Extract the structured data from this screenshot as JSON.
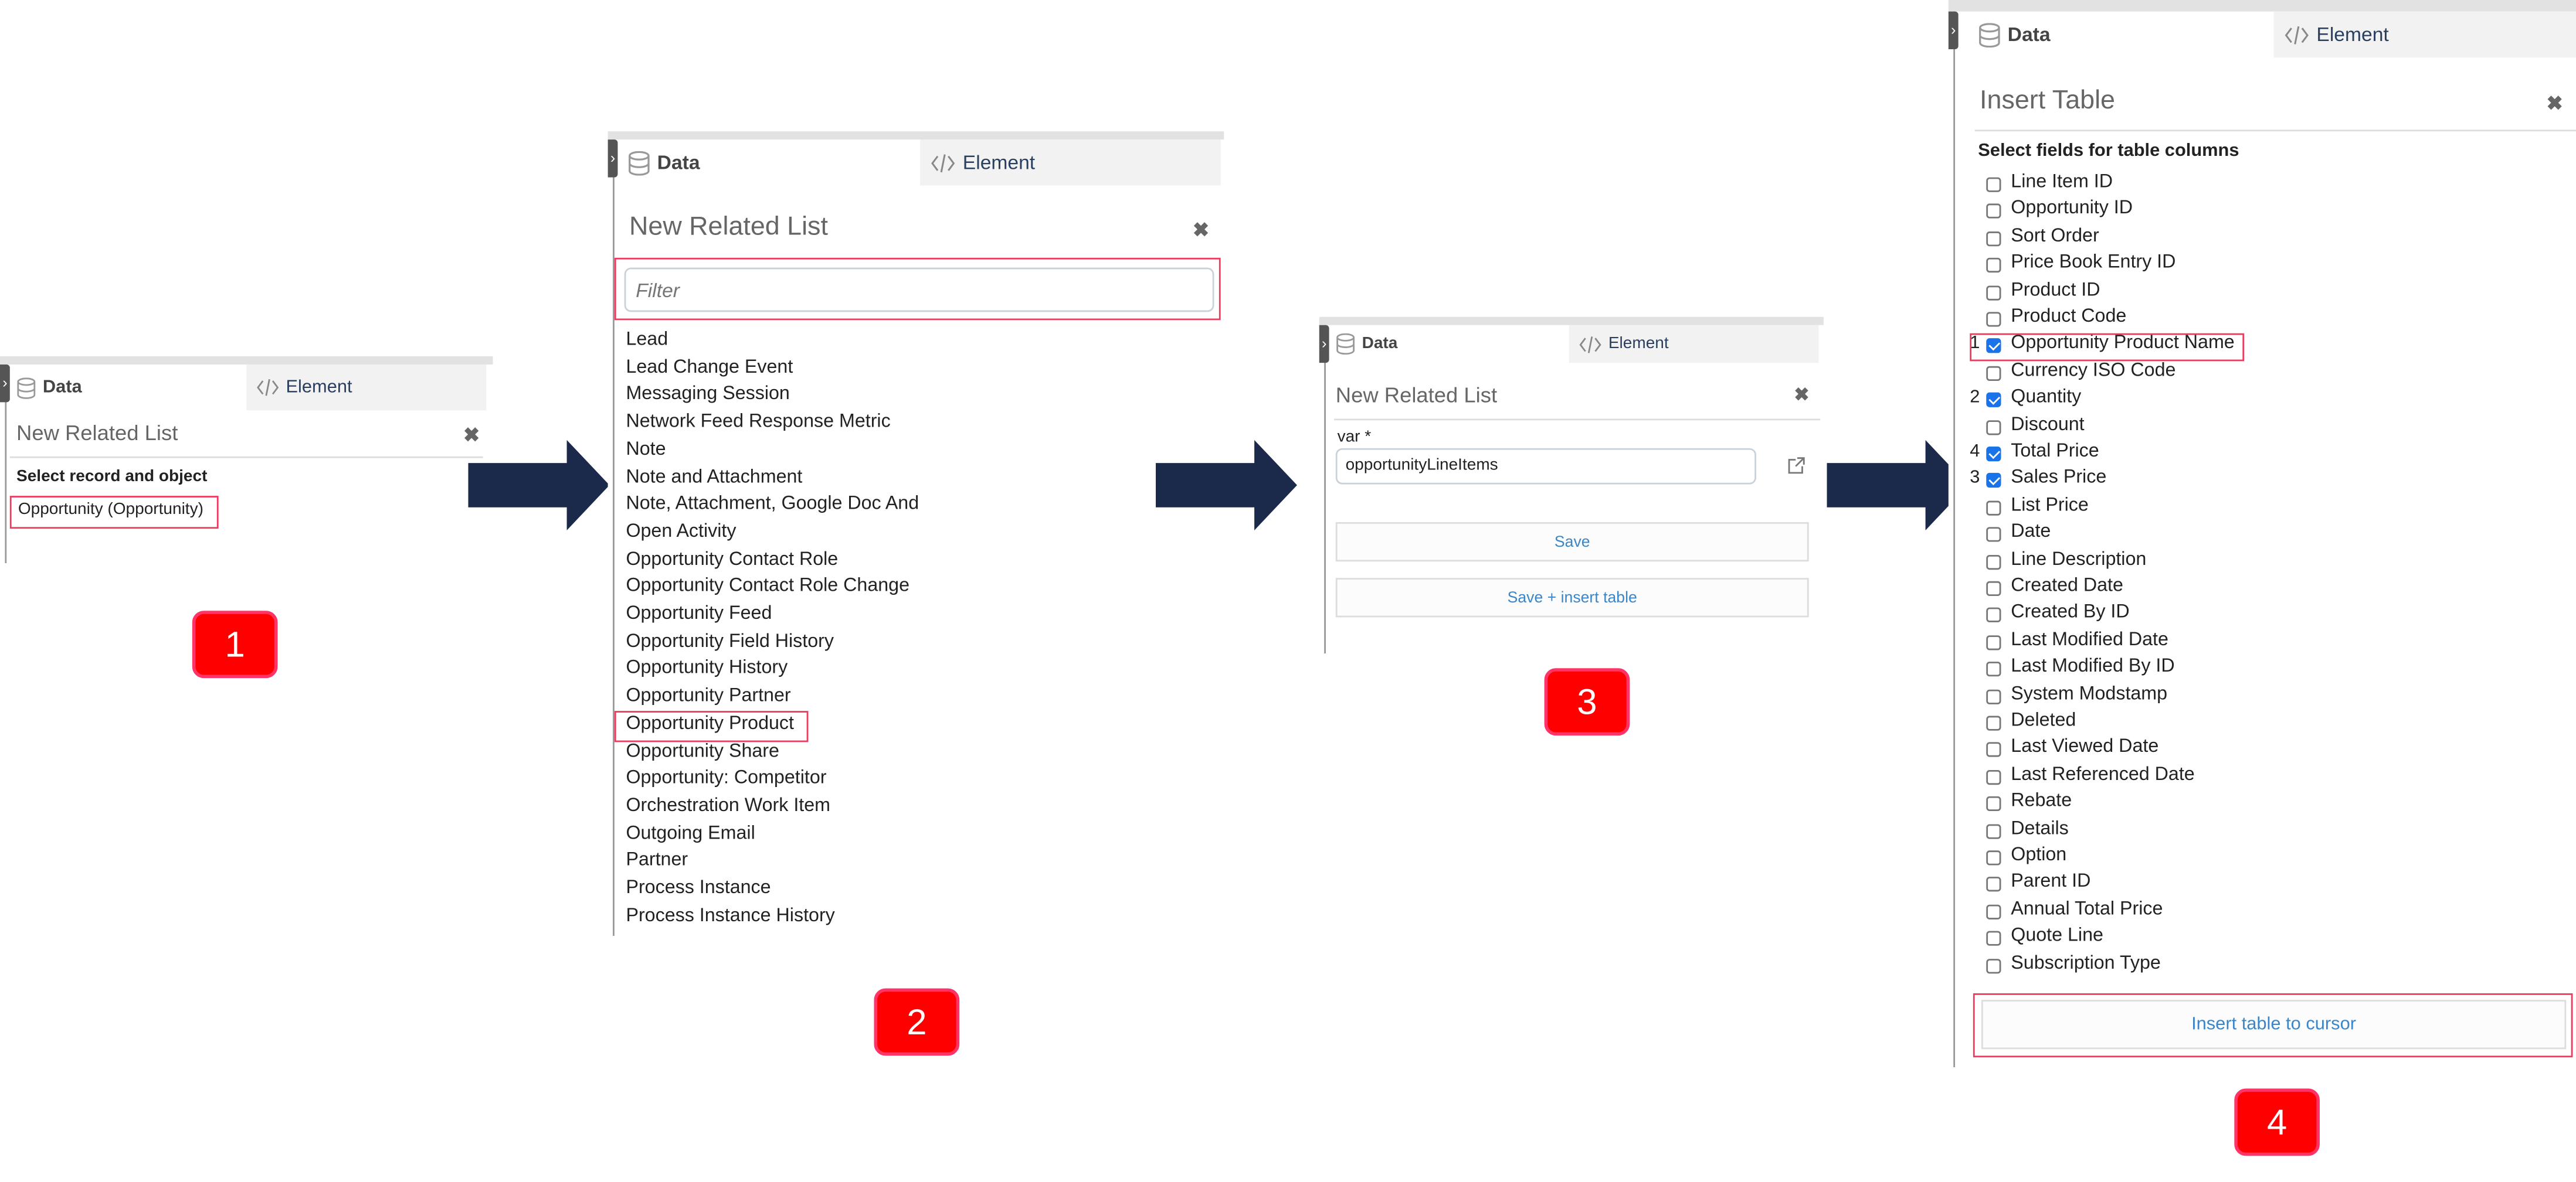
{
  "colors": {
    "arrow": "#1b2a4a",
    "highlight": "#ee3a5e",
    "badge": "#ff0000",
    "checkbox": "#1a73e8",
    "button_text": "#3a86c8"
  },
  "tabs": {
    "data": "Data",
    "element": "Element",
    "data_icon": "database-icon",
    "element_icon": "code-icon"
  },
  "step1": {
    "badge": "1",
    "title": "New Related List",
    "section": "Select record and object",
    "selected": "Opportunity (Opportunity)"
  },
  "step2": {
    "badge": "2",
    "title": "New Related List",
    "filter_placeholder": "Filter",
    "filter_value": "",
    "items": [
      "Lead",
      "Lead Change Event",
      "Messaging Session",
      "Network Feed Response Metric",
      "Note",
      "Note and Attachment",
      "Note, Attachment, Google Doc And",
      "Open Activity",
      "Opportunity Contact Role",
      "Opportunity Contact Role Change",
      "Opportunity Feed",
      "Opportunity Field History",
      "Opportunity History",
      "Opportunity Partner",
      "Opportunity Product",
      "Opportunity Share",
      "Opportunity: Competitor",
      "Orchestration Work Item",
      "Outgoing Email",
      "Partner",
      "Process Instance",
      "Process Instance History"
    ],
    "highlighted": "Opportunity Product"
  },
  "step3": {
    "badge": "3",
    "title": "New Related List",
    "var_label": "var *",
    "var_value": "opportunityLineItems",
    "save": "Save",
    "save_insert": "Save + insert table"
  },
  "step4": {
    "badge": "4",
    "title": "Insert Table",
    "section": "Select fields for table columns",
    "insert_button": "Insert table to cursor",
    "fields": [
      {
        "label": "Line Item ID",
        "checked": false
      },
      {
        "label": "Opportunity ID",
        "checked": false
      },
      {
        "label": "Sort Order",
        "checked": false
      },
      {
        "label": "Price Book Entry ID",
        "checked": false
      },
      {
        "label": "Product ID",
        "checked": false
      },
      {
        "label": "Product Code",
        "checked": false
      },
      {
        "label": "Opportunity Product Name",
        "checked": true,
        "order": "1"
      },
      {
        "label": "Currency ISO Code",
        "checked": false
      },
      {
        "label": "Quantity",
        "checked": true,
        "order": "2"
      },
      {
        "label": "Discount",
        "checked": false
      },
      {
        "label": "Total Price",
        "checked": true,
        "order": "4"
      },
      {
        "label": "Sales Price",
        "checked": true,
        "order": "3"
      },
      {
        "label": "List Price",
        "checked": false
      },
      {
        "label": "Date",
        "checked": false
      },
      {
        "label": "Line Description",
        "checked": false
      },
      {
        "label": "Created Date",
        "checked": false
      },
      {
        "label": "Created By ID",
        "checked": false
      },
      {
        "label": "Last Modified Date",
        "checked": false
      },
      {
        "label": "Last Modified By ID",
        "checked": false
      },
      {
        "label": "System Modstamp",
        "checked": false
      },
      {
        "label": "Deleted",
        "checked": false
      },
      {
        "label": "Last Viewed Date",
        "checked": false
      },
      {
        "label": "Last Referenced Date",
        "checked": false
      },
      {
        "label": "Rebate",
        "checked": false
      },
      {
        "label": "Details",
        "checked": false
      },
      {
        "label": "Option",
        "checked": false
      },
      {
        "label": "Parent ID",
        "checked": false
      },
      {
        "label": "Annual Total Price",
        "checked": false
      },
      {
        "label": "Quote Line",
        "checked": false
      },
      {
        "label": "Subscription Type",
        "checked": false
      }
    ]
  }
}
